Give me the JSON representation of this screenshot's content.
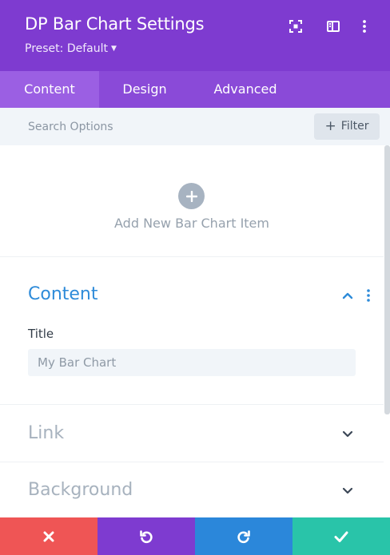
{
  "header": {
    "title": "DP Bar Chart Settings",
    "preset_label": "Preset: Default",
    "bg_color": "#7e3bd0",
    "icons": [
      "expand-icon",
      "sidebar-toggle-icon",
      "more-vertical-icon"
    ]
  },
  "tabs": [
    {
      "label": "Content",
      "active": true
    },
    {
      "label": "Design",
      "active": false
    },
    {
      "label": "Advanced",
      "active": false
    }
  ],
  "search": {
    "placeholder": "Search Options",
    "value": "",
    "filter_label": "Filter"
  },
  "add_item": {
    "label": "Add New Bar Chart Item"
  },
  "sections": {
    "content": {
      "title": "Content",
      "expanded": true,
      "field_label": "Title",
      "field_value": "My Bar Chart"
    },
    "link": {
      "title": "Link",
      "expanded": false
    },
    "background": {
      "title": "Background",
      "expanded": false
    }
  },
  "footer": {
    "buttons": [
      {
        "name": "cancel",
        "icon": "close-icon",
        "color": "#ef5555"
      },
      {
        "name": "undo",
        "icon": "undo-icon",
        "color": "#7e3bd0"
      },
      {
        "name": "redo",
        "icon": "redo-icon",
        "color": "#2b87da"
      },
      {
        "name": "save",
        "icon": "check-icon",
        "color": "#29c4a9"
      }
    ]
  }
}
